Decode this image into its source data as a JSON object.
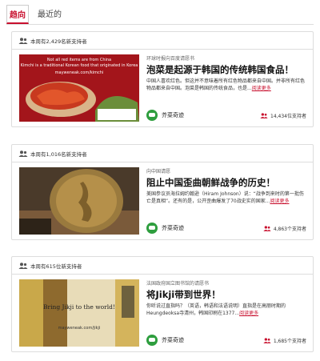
{
  "tabs": [
    {
      "label": "趋向",
      "active": true
    },
    {
      "label": "最近的",
      "active": false
    }
  ],
  "cards": [
    {
      "header": "本周有2,429名新支持者",
      "eyebrow": "环球时报向百度请愿书",
      "title": "泡菜是起源于韩国的传统韩国食品！",
      "desc": "中国人喜欢红色。但这并不意味着所有红色物品都来自中国。并非所有红色物品都来自中国。泡菜是韩国的传统食品，也是...",
      "more": "阅读更多",
      "org": "芥菜奇迹",
      "supporters": "14,434位支持者",
      "image_lines": [
        "Not all red items are from China",
        "Kimchi is a traditional Korean food that originated in Korea",
        "mayweneak.com/kimchi"
      ]
    },
    {
      "header": "本周有1,016名新支持者",
      "eyebrow": "向中国请愿",
      "title": "阻止中国歪曲朝鲜战争的历史！",
      "desc": "美国参议员海拉姆约翰逊（Hiram Johnson）说：“战争到来时的第一批伤亡是真相”。还有的是，公开歪曲爆发了70战史实的国家...",
      "more": "阅读更多",
      "org": "芥菜奇迹",
      "supporters": "4,863个支持者",
      "image_lines": []
    },
    {
      "header": "本周有615位新支持者",
      "eyebrow": "法国政府国立图书馆的请愿书",
      "title": "将Jikji带到世界！",
      "desc": "你听说过直指吗？（英语，韩语和法语说明）直指是在高丽时期的Heungdeoksa寺清州，韩国印刷在1377...",
      "more": "阅读更多",
      "org": "芥菜奇迹",
      "supporters": "1,685个支持者",
      "image_lines": [
        "Bring Jikji to the world!",
        "mayweneak.com/jikji"
      ]
    }
  ],
  "colors": {
    "accent": "#c8102e",
    "org_green": "#2e9e3e"
  },
  "icons": {
    "people": "people-icon",
    "org": "org-icon"
  }
}
